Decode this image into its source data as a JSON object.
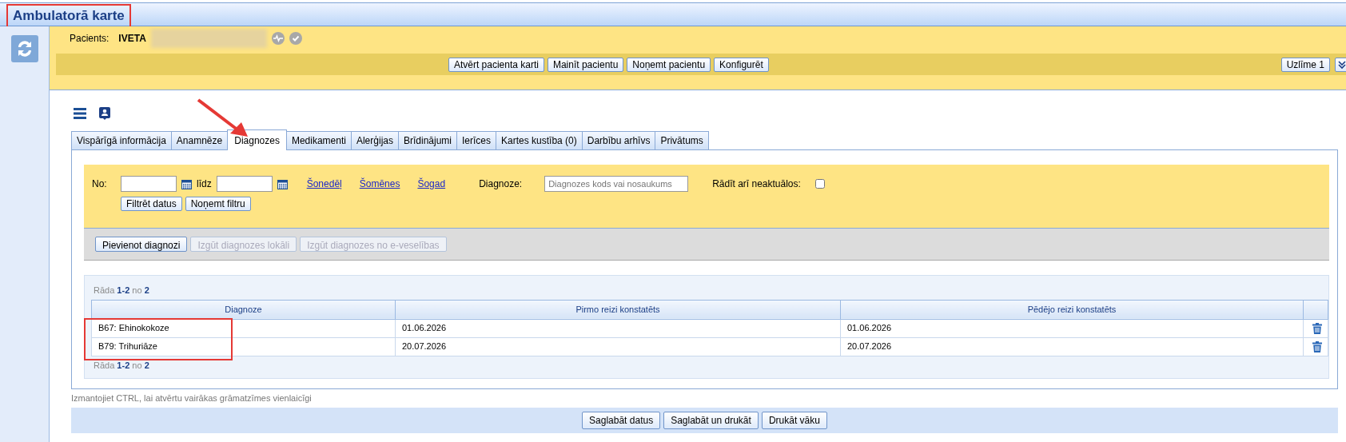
{
  "window": {
    "title": "Ambulatorā karte"
  },
  "patient": {
    "label": "Pacients:",
    "name": "IVETA"
  },
  "toolbar": {
    "buttons": [
      "Atvērt pacienta karti",
      "Mainīt pacientu",
      "Noņemt pacientu",
      "Konfigurēt"
    ],
    "sticker_button": "Uzlīme 1"
  },
  "tabs": [
    {
      "label": "Vispārīgā informācija",
      "selected": false
    },
    {
      "label": "Anamnēze",
      "selected": false
    },
    {
      "label": "Diagnozes",
      "selected": true
    },
    {
      "label": "Medikamenti",
      "selected": false
    },
    {
      "label": "Alerģijas",
      "selected": false
    },
    {
      "label": "Brīdinājumi",
      "selected": false
    },
    {
      "label": "Ierīces",
      "selected": false
    },
    {
      "label": "Kartes kustība (0)",
      "selected": false
    },
    {
      "label": "Darbību arhīvs",
      "selected": false
    },
    {
      "label": "Privātums",
      "selected": false
    }
  ],
  "filter": {
    "from_label": "No:",
    "to_label": "līdz",
    "quick_links": [
      "Šonedēļ",
      "Šomēnes",
      "Šogad"
    ],
    "diagnosis_label": "Diagnoze:",
    "diagnosis_placeholder": "Diagnozes kods vai nosaukums",
    "show_inactive_label": "Rādīt arī neaktuālos:",
    "show_inactive_checked": false,
    "buttons": [
      "Filtrēt datus",
      "Noņemt filtru"
    ]
  },
  "actions": [
    {
      "label": "Pievienot diagnozi",
      "disabled": false
    },
    {
      "label": "Izgūt diagnozes lokāli",
      "disabled": true
    },
    {
      "label": "Izgūt diagnozes no e-veselības",
      "disabled": true
    }
  ],
  "pager_top": "Rāda **1-2** no **2**",
  "table": {
    "columns": [
      "Diagnoze",
      "Pirmo reizi konstatēts",
      "Pēdējo reizi konstatēts"
    ],
    "rows": [
      {
        "cells": [
          "B67: Ehinokokoze",
          "01.06.2026",
          "01.06.2026"
        ]
      },
      {
        "cells": [
          "B79: Trihuriāze",
          "20.07.2026",
          "20.07.2026"
        ]
      }
    ]
  },
  "pager_bottom": "Rāda **1-2** no **2**",
  "hint": "Izmantojiet CTRL, lai atvērtu vairākas grāmatzīmes vienlaicīgi",
  "footer_buttons": [
    "Saglabāt datus",
    "Saglabāt un drukāt",
    "Drukāt vāku"
  ]
}
